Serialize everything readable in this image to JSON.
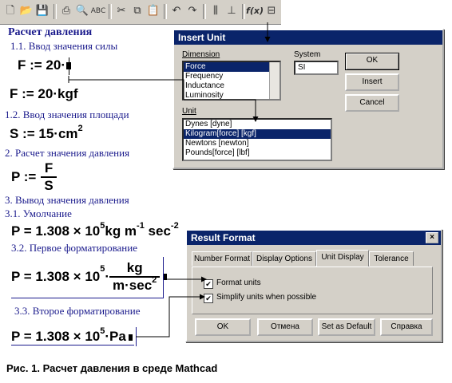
{
  "toolbar": {
    "icons": [
      "new-icon",
      "open-icon",
      "save-icon",
      "print-icon",
      "preview-icon",
      "spellcheck-icon",
      "cut-icon",
      "copy-icon",
      "paste-icon",
      "undo-icon",
      "redo-icon",
      "align-icon",
      "align-vertical-icon",
      "insert-function-icon",
      "insert-unit-icon"
    ],
    "fx_label": "f(x)"
  },
  "worksheet": {
    "title": "Расчет давления",
    "s1_1": "1.1. Ввод значения силы",
    "s1_2": "1.2. Ввод значения площади",
    "s2": "2. Расчет значения давления",
    "s3": "3. Вывод значения давления",
    "s3_1": "3.1. Умолчание",
    "s3_2": "3.2. Первое форматирование",
    "s3_3": "3.3. Второе форматирование"
  },
  "math": {
    "f_input": "F := 20·",
    "f_result": "F := 20·kgf",
    "s_prefix": "S := 15·cm",
    "s_exp": "2",
    "p_lhs": "P :=",
    "p_num": "F",
    "p_den": "S",
    "r1_prefix": "P = 1.308 × 10",
    "r1_exp": "5",
    "r1_unit_a": "kg m",
    "r1_exp_a": "-1",
    "r1_unit_b": " sec",
    "r1_exp_b": "-2",
    "r2_prefix": "P = 1.308 × 10",
    "r2_exp": "5",
    "r2_dot": "·",
    "r2_num": "kg",
    "r2_den": "m·sec",
    "r2_den_exp": "2",
    "r3_prefix": "P = 1.308 × 10",
    "r3_exp": "5",
    "r3_unit": "·Pa"
  },
  "insert_unit": {
    "title": "Insert Unit",
    "dimension_label": "Dimension",
    "system_label": "System",
    "system_value": "SI",
    "dimensions": [
      "Force",
      "Frequency",
      "Inductance",
      "Luminosity"
    ],
    "unit_label": "Unit",
    "units": [
      "Dynes [dyne]",
      "Kilogram[force] [kgf]",
      "Newtons [newton]",
      "Pounds[force] [lbf]"
    ],
    "ok": "OK",
    "insert": "Insert",
    "cancel": "Cancel"
  },
  "result_format": {
    "title": "Result Format",
    "tabs": [
      "Number Format",
      "Display Options",
      "Unit Display",
      "Tolerance"
    ],
    "format_units": "Format units",
    "simplify_units": "Simplify units when possible",
    "ok": "OK",
    "cancel": "Отмена",
    "set_default": "Set as Default",
    "help": "Справка"
  },
  "caption": "Рис. 1. Расчет давления в среде Mathcad"
}
